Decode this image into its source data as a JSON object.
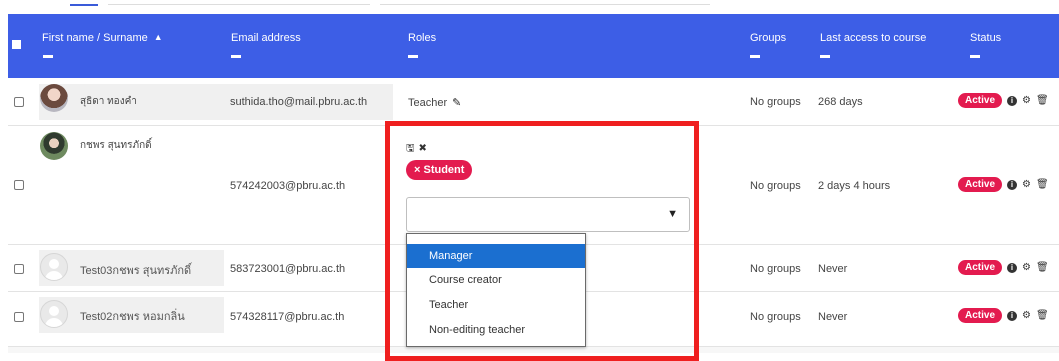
{
  "table": {
    "headers": {
      "name": "First name / Surname",
      "email": "Email address",
      "roles": "Roles",
      "groups": "Groups",
      "last_access": "Last access to course",
      "status": "Status"
    },
    "rows": [
      {
        "name": "สุธิดา ทองคำ",
        "email": "suthida.tho@mail.pbru.ac.th",
        "role": "Teacher",
        "groups": "No groups",
        "last_access": "268 days",
        "status": "Active"
      },
      {
        "name": "กชพร สุนทรภักดิ์",
        "email": "574242003@pbru.ac.th",
        "role": "",
        "groups": "No groups",
        "last_access": "2 days 4 hours",
        "status": "Active"
      },
      {
        "name": "Test03กชพร สุนทรภักดิ์",
        "email": "583723001@pbru.ac.th",
        "role": "",
        "groups": "No groups",
        "last_access": "Never",
        "status": "Active"
      },
      {
        "name": "Test02กชพร หอมกลิ่น",
        "email": "574328117@pbru.ac.th",
        "role": "",
        "groups": "No groups",
        "last_access": "Never",
        "status": "Active"
      }
    ]
  },
  "role_editor": {
    "assigned_role": "× Student",
    "select_value": "",
    "options": [
      "Manager",
      "Course creator",
      "Teacher",
      "Non-editing teacher"
    ],
    "selected_option": "Manager"
  },
  "icons": {
    "sort": "caret-up-icon",
    "edit": "pencil-icon",
    "save": "floppy-disk-icon",
    "cancel": "close-icon",
    "info": "info-icon",
    "settings": "gear-icon",
    "delete": "trash-icon",
    "dropdown": "caret-down-icon"
  },
  "colors": {
    "header_bg": "#3d5ee6",
    "badge": "#e31b4f",
    "highlight": "#ef1f1f",
    "option_selected": "#1b6fd0"
  }
}
